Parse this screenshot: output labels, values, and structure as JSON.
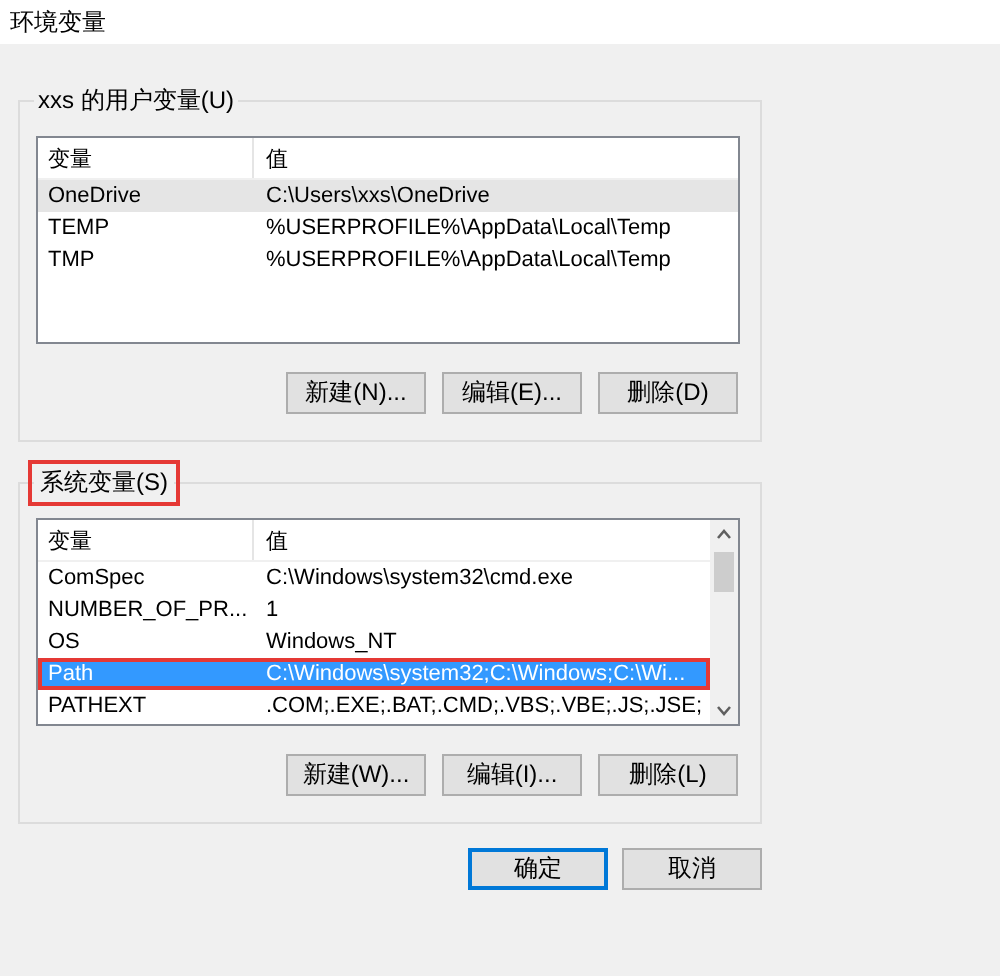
{
  "window": {
    "title": "环境变量"
  },
  "groups": [
    {
      "legend": "xxs 的用户变量(U)",
      "highlighted": false,
      "columns": [
        "变量",
        "值"
      ],
      "rows": [
        {
          "name": "OneDrive",
          "value": "C:\\Users\\xxs\\OneDrive",
          "selected": false,
          "hovered": true,
          "highlighted": false
        },
        {
          "name": "TEMP",
          "value": "%USERPROFILE%\\AppData\\Local\\Temp",
          "selected": false,
          "hovered": false,
          "highlighted": false
        },
        {
          "name": "TMP",
          "value": "%USERPROFILE%\\AppData\\Local\\Temp",
          "selected": false,
          "hovered": false,
          "highlighted": false
        }
      ],
      "buttons": [
        "新建(N)...",
        "编辑(E)...",
        "删除(D)"
      ]
    },
    {
      "legend": "系统变量(S)",
      "highlighted": true,
      "columns": [
        "变量",
        "值"
      ],
      "rows": [
        {
          "name": "ComSpec",
          "value": "C:\\Windows\\system32\\cmd.exe",
          "selected": false,
          "hovered": false,
          "highlighted": false
        },
        {
          "name": "NUMBER_OF_PR...",
          "value": "1",
          "selected": false,
          "hovered": false,
          "highlighted": false
        },
        {
          "name": "OS",
          "value": "Windows_NT",
          "selected": false,
          "hovered": false,
          "highlighted": false
        },
        {
          "name": "Path",
          "value": "C:\\Windows\\system32;C:\\Windows;C:\\Wi...",
          "selected": true,
          "hovered": false,
          "highlighted": true
        },
        {
          "name": "PATHEXT",
          "value": ".COM;.EXE;.BAT;.CMD;.VBS;.VBE;.JS;.JSE;",
          "selected": false,
          "hovered": false,
          "highlighted": false
        }
      ],
      "buttons": [
        "新建(W)...",
        "编辑(I)...",
        "删除(L)"
      ]
    }
  ],
  "dialog_buttons": [
    {
      "label": "确定",
      "default": true
    },
    {
      "label": "取消",
      "default": false
    }
  ]
}
